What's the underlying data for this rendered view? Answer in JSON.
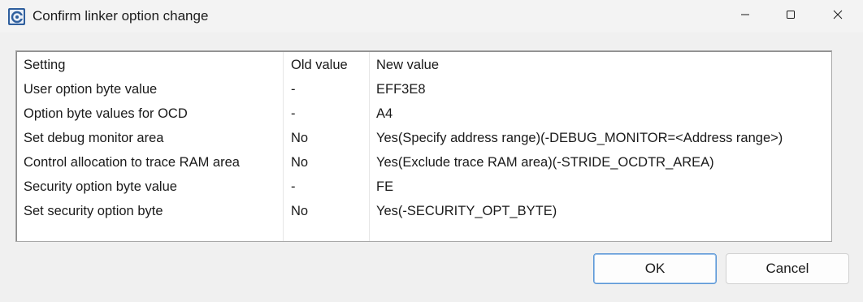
{
  "window": {
    "title": "Confirm linker option change",
    "icon": "linker-app-icon",
    "controls": [
      "minimize-icon",
      "maximize-icon",
      "close-icon"
    ]
  },
  "table": {
    "headers": [
      "Setting",
      "Old value",
      "New value"
    ],
    "rows": [
      [
        "User option byte value",
        "-",
        "EFF3E8"
      ],
      [
        "Option byte values for OCD",
        "-",
        "A4"
      ],
      [
        "Set debug monitor area",
        "No",
        "Yes(Specify address range)(-DEBUG_MONITOR=<Address range>)"
      ],
      [
        "Control allocation to trace RAM area",
        "No",
        "Yes(Exclude trace RAM area)(-STRIDE_OCDTR_AREA)"
      ],
      [
        "Security option byte value",
        "-",
        "FE"
      ],
      [
        "Set security option byte",
        "No",
        "Yes(-SECURITY_OPT_BYTE)"
      ]
    ]
  },
  "buttons": {
    "ok_label": "OK",
    "cancel_label": "Cancel"
  },
  "colors": {
    "accent": "#5a96d6",
    "window_bg": "#f0f0f0"
  }
}
